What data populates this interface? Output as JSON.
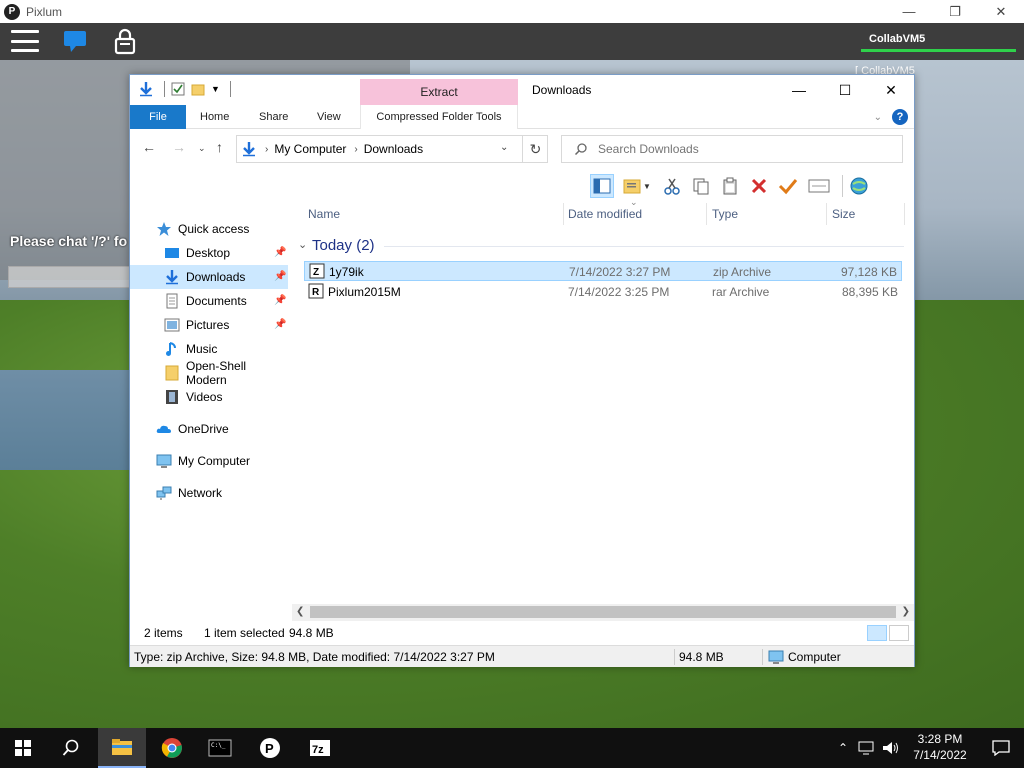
{
  "host": {
    "app_title": "Pixlum",
    "vm_name": "CollabVM5",
    "vm_side_label": "CollabVM5",
    "chat_hint": "Please chat '/?' fo",
    "chat_placeholder": ""
  },
  "explorer": {
    "window_title": "Downloads",
    "contextual_tab_group": "Extract",
    "tabs": {
      "file": "File",
      "home": "Home",
      "share": "Share",
      "view": "View",
      "compressed": "Compressed Folder Tools"
    },
    "breadcrumb": [
      "My Computer",
      "Downloads"
    ],
    "search_placeholder": "Search Downloads",
    "nav": {
      "quick_access": "Quick access",
      "desktop": "Desktop",
      "downloads": "Downloads",
      "documents": "Documents",
      "pictures": "Pictures",
      "music": "Music",
      "open_shell": "Open-Shell Modern",
      "videos": "Videos",
      "onedrive": "OneDrive",
      "my_computer": "My Computer",
      "network": "Network"
    },
    "columns": {
      "name": "Name",
      "date": "Date modified",
      "type": "Type",
      "size": "Size"
    },
    "group_title": "Today (2)",
    "files": [
      {
        "name": "1y79ik",
        "date": "7/14/2022 3:27 PM",
        "type": "zip Archive",
        "size": "97,128 KB",
        "icon": "zip-archive-icon",
        "selected": true
      },
      {
        "name": "Pixlum2015M",
        "date": "7/14/2022 3:25 PM",
        "type": "rar Archive",
        "size": "88,395 KB",
        "icon": "rar-archive-icon",
        "selected": false
      }
    ],
    "status": {
      "items": "2 items",
      "selected": "1 item selected",
      "selected_size": "94.8 MB",
      "details": "Type: zip Archive, Size: 94.8 MB, Date modified: 7/14/2022 3:27 PM",
      "size": "94.8 MB",
      "location": "Computer"
    }
  },
  "taskbar": {
    "time": "3:28 PM",
    "date": "7/14/2022",
    "apps": [
      "start-icon",
      "search-icon",
      "file-explorer-icon",
      "chrome-icon",
      "terminal-icon",
      "pixlum-icon",
      "7zip-icon"
    ]
  },
  "colors": {
    "accent": "#1979ca",
    "selection": "#cce8ff",
    "vm_progress": "#2fd14b",
    "contextual_tab": "#f7c2da"
  }
}
